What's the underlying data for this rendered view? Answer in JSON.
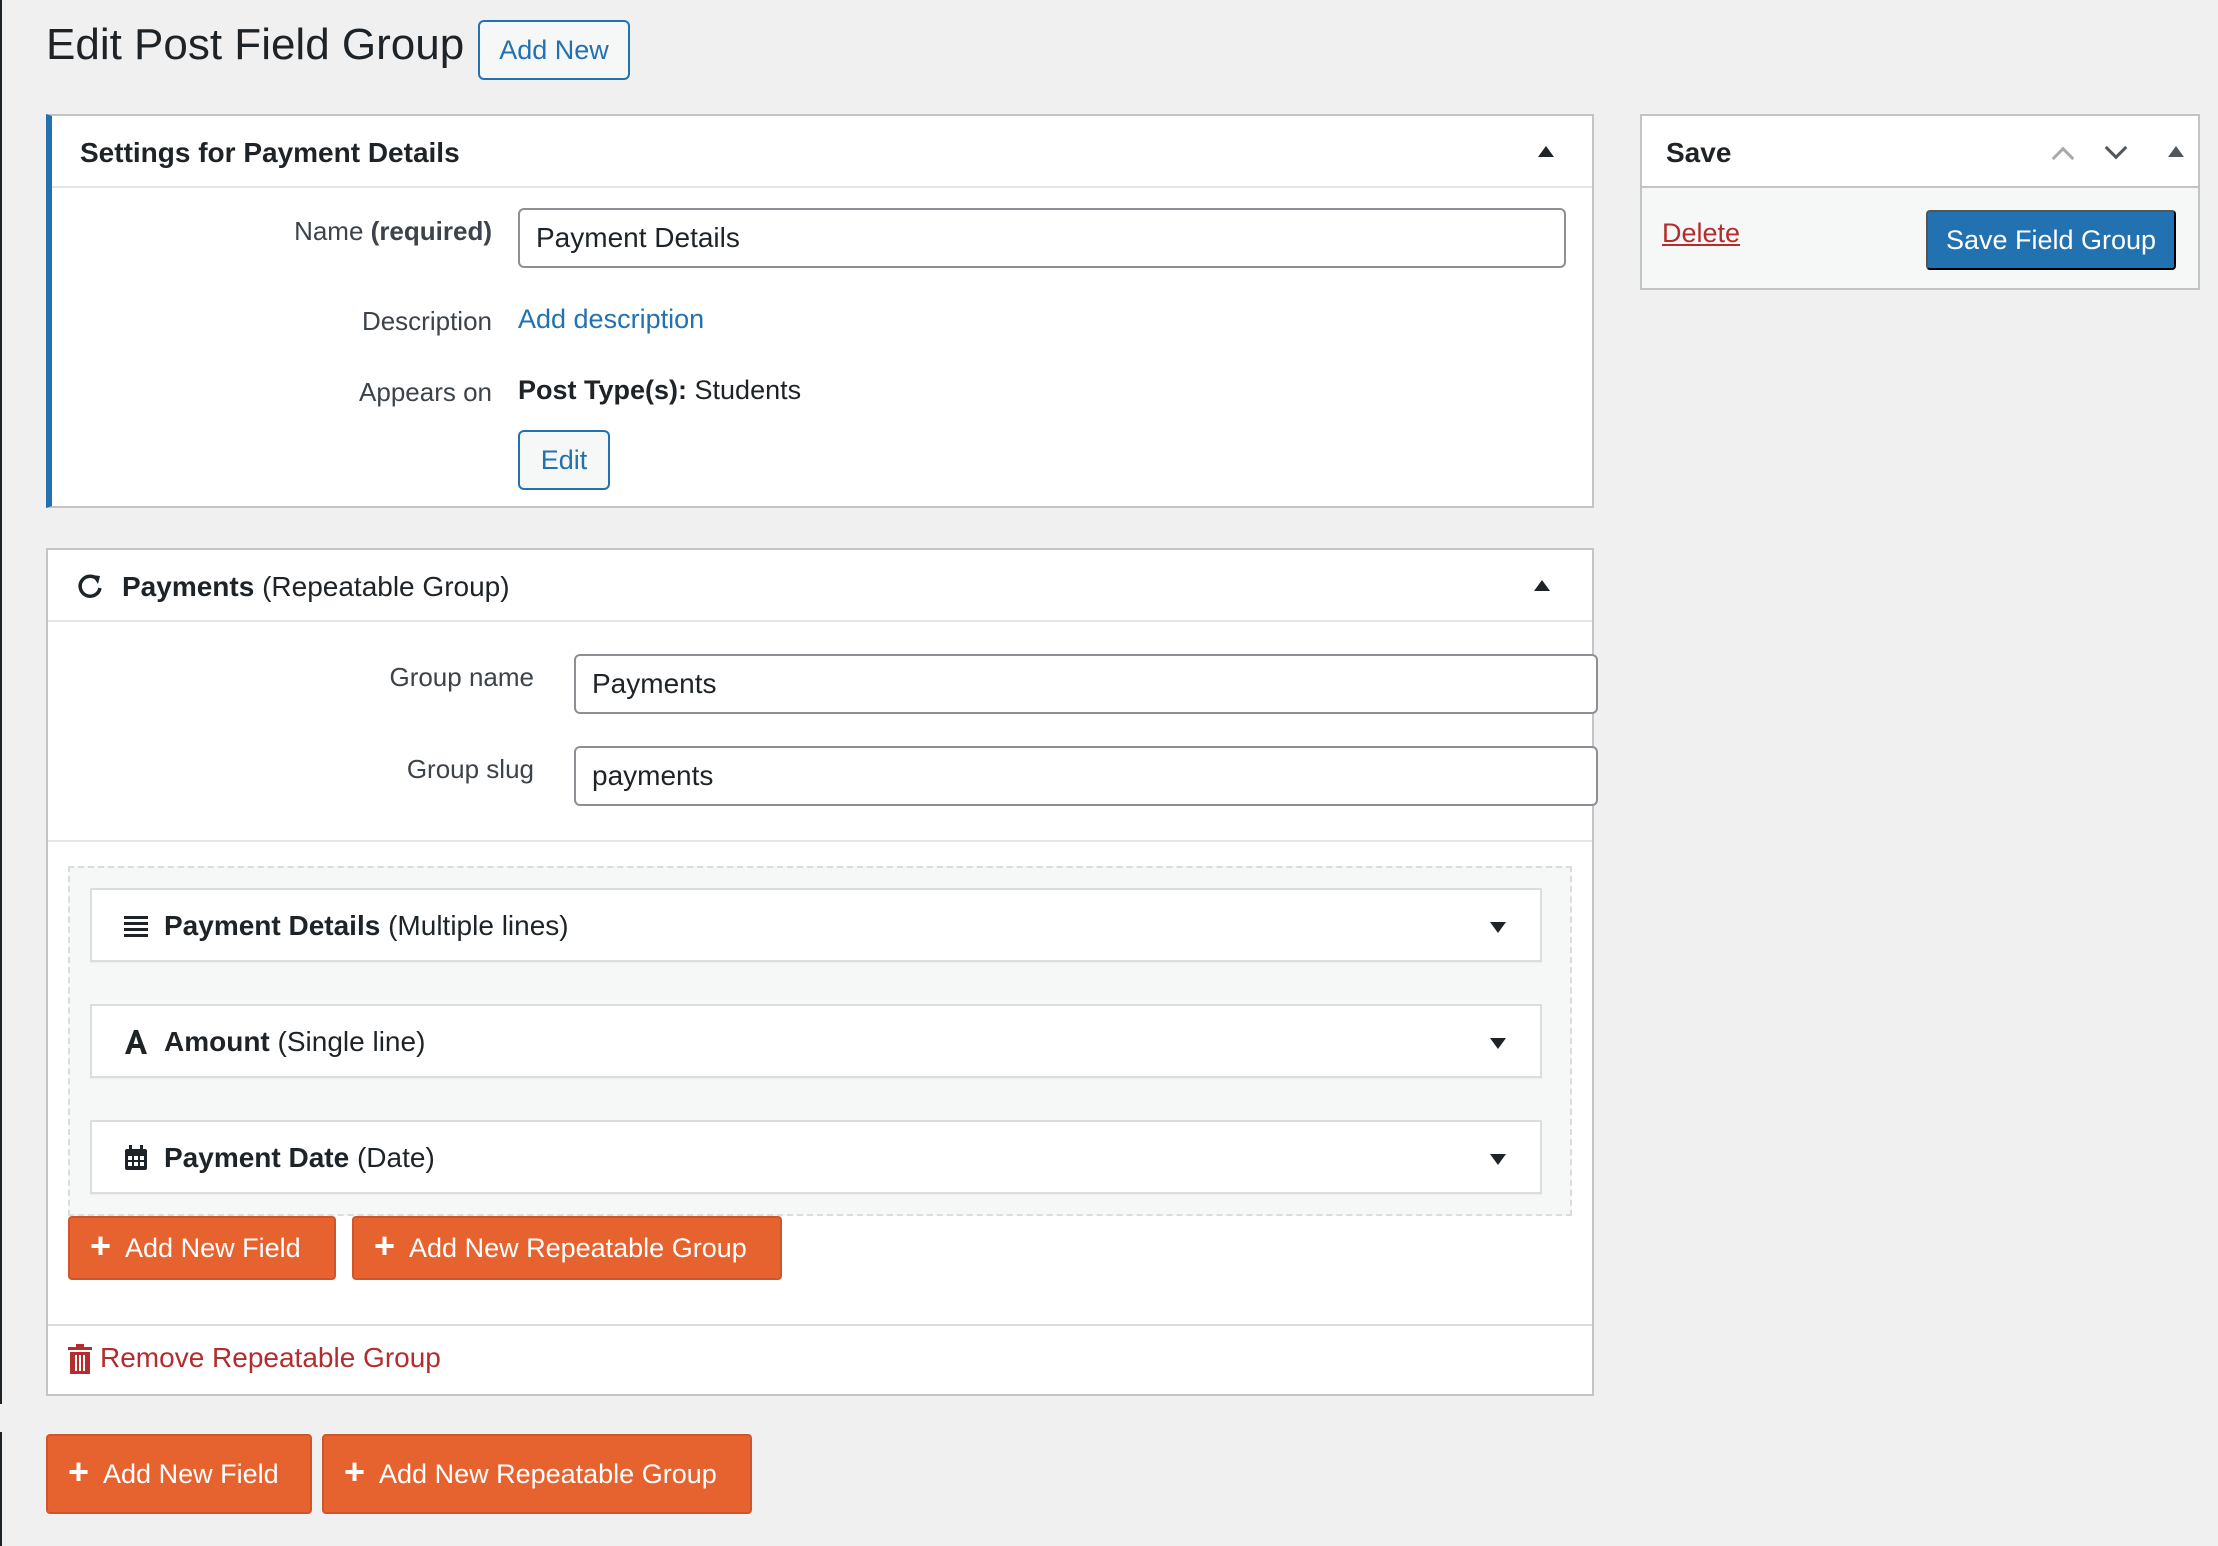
{
  "header": {
    "title": "Edit Post Field Group",
    "add_new_label": "Add New"
  },
  "settings_panel": {
    "title": "Settings for Payment Details",
    "name_label": "Name",
    "name_required": "(required)",
    "name_value": "Payment Details",
    "description_label": "Description",
    "add_description_link": "Add description",
    "appears_on_label": "Appears on",
    "post_types_label": "Post Type(s):",
    "post_types_value": "Students",
    "edit_button": "Edit"
  },
  "save_panel": {
    "title": "Save",
    "delete_link": "Delete",
    "save_button": "Save Field Group"
  },
  "repeatable_group": {
    "name": "Payments",
    "type": "(Repeatable Group)",
    "group_name_label": "Group name",
    "group_name_value": "Payments",
    "group_slug_label": "Group slug",
    "group_slug_value": "payments",
    "fields": [
      {
        "name": "Payment Details",
        "type": "(Multiple lines)",
        "icon": "multiple-lines-icon"
      },
      {
        "name": "Amount",
        "type": "(Single line)",
        "icon": "single-line-icon"
      },
      {
        "name": "Payment Date",
        "type": "(Date)",
        "icon": "calendar-icon"
      }
    ],
    "add_field_button": "Add New Field",
    "add_group_button": "Add New Repeatable Group",
    "remove_link": "Remove Repeatable Group"
  },
  "footer_actions": {
    "add_field_button": "Add New Field",
    "add_group_button": "Add New Repeatable Group"
  },
  "colors": {
    "accent_blue": "#2271b1",
    "orange": "#e6632f",
    "danger_red": "#b32d2e",
    "background": "#f0f0f1"
  }
}
